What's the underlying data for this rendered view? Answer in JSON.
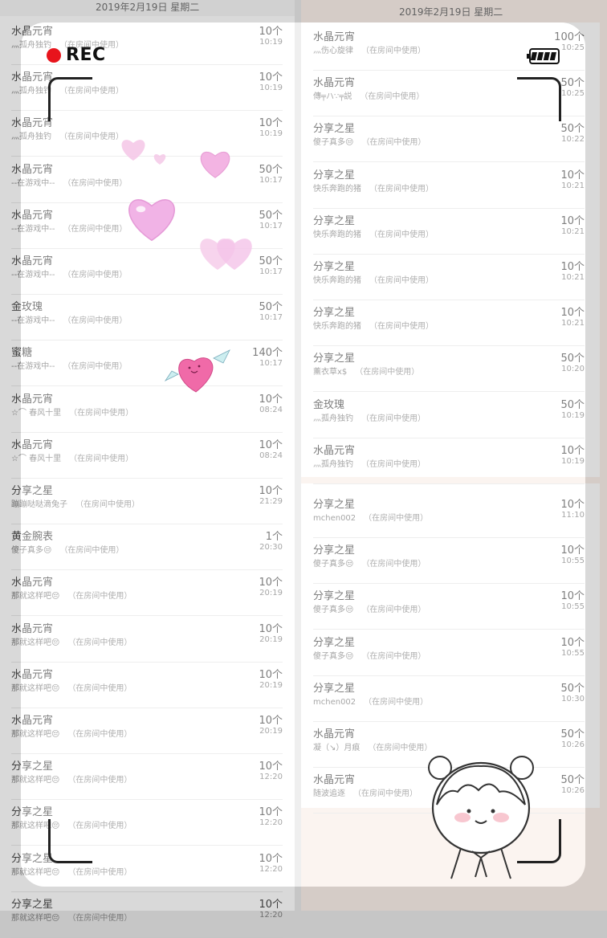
{
  "left_date": "2019年2月19日 星期二",
  "right_date": "2019年2月19日 星期二",
  "overlay": {
    "rec_label": "REC"
  },
  "left_list": [
    {
      "title": "水晶元宵",
      "sub": "灬孤舟独钓",
      "hint": "（在房间中使用）",
      "amount": "10个",
      "time": "10:19"
    },
    {
      "title": "水晶元宵",
      "sub": "灬孤舟独钓",
      "hint": "（在房间中使用）",
      "amount": "10个",
      "time": "10:19"
    },
    {
      "title": "水晶元宵",
      "sub": "灬孤舟独钓",
      "hint": "（在房间中使用）",
      "amount": "10个",
      "time": "10:19"
    },
    {
      "title": "水晶元宵",
      "sub": "--在游戏中--",
      "hint": "（在房间中使用）",
      "amount": "50个",
      "time": "10:17"
    },
    {
      "title": "水晶元宵",
      "sub": "--在游戏中--",
      "hint": "（在房间中使用）",
      "amount": "50个",
      "time": "10:17"
    },
    {
      "title": "水晶元宵",
      "sub": "--在游戏中--",
      "hint": "（在房间中使用）",
      "amount": "50个",
      "time": "10:17"
    },
    {
      "title": "金玫瑰",
      "sub": "--在游戏中--",
      "hint": "（在房间中使用）",
      "amount": "50个",
      "time": "10:17"
    },
    {
      "title": "蜜糖",
      "sub": "--在游戏中--",
      "hint": "（在房间中使用）",
      "amount": "140个",
      "time": "10:17"
    },
    {
      "title": "水晶元宵",
      "sub": "☆⌒ 春风十里",
      "hint": "（在房间中使用）",
      "amount": "10个",
      "time": "08:24"
    },
    {
      "title": "水晶元宵",
      "sub": "☆⌒ 春风十里",
      "hint": "（在房间中使用）",
      "amount": "10个",
      "time": "08:24"
    },
    {
      "title": "分享之星",
      "sub": "蹦蹦哒哒滴兔子",
      "hint": "（在房间中使用）",
      "amount": "10个",
      "time": "21:29"
    },
    {
      "title": "黄金腕表",
      "sub": "傻子真多😒",
      "hint": "（在房间中使用）",
      "amount": "1个",
      "time": "20:30"
    },
    {
      "title": "水晶元宵",
      "sub": "那就这样吧😔",
      "hint": "（在房间中使用）",
      "amount": "10个",
      "time": "20:19"
    },
    {
      "title": "水晶元宵",
      "sub": "那就这样吧😔",
      "hint": "（在房间中使用）",
      "amount": "10个",
      "time": "20:19"
    },
    {
      "title": "水晶元宵",
      "sub": "那就这样吧😔",
      "hint": "（在房间中使用）",
      "amount": "10个",
      "time": "20:19"
    },
    {
      "title": "水晶元宵",
      "sub": "那就这样吧😔",
      "hint": "（在房间中使用）",
      "amount": "10个",
      "time": "20:19"
    },
    {
      "title": "分享之星",
      "sub": "那就这样吧😔",
      "hint": "（在房间中使用）",
      "amount": "10个",
      "time": "12:20"
    },
    {
      "title": "分享之星",
      "sub": "那就这样吧😔",
      "hint": "（在房间中使用）",
      "amount": "10个",
      "time": "12:20"
    },
    {
      "title": "分享之星",
      "sub": "那就这样吧😔",
      "hint": "（在房间中使用）",
      "amount": "10个",
      "time": "12:20"
    },
    {
      "title": "分享之星",
      "sub": "那就这样吧😔",
      "hint": "（在房间中使用）",
      "amount": "10个",
      "time": "12:20"
    }
  ],
  "right_list_top": [
    {
      "title": "水晶元宵",
      "sub": "灬伤心旋律",
      "hint": "（在房间中使用）",
      "amount": "100个",
      "time": "10:25"
    },
    {
      "title": "水晶元宵",
      "sub": "傳╤ハ∵╤説",
      "hint": "（在房间中使用）",
      "amount": "50个",
      "time": "10:25"
    },
    {
      "title": "分享之星",
      "sub": "傻子真多😒",
      "hint": "（在房间中使用）",
      "amount": "50个",
      "time": "10:22"
    },
    {
      "title": "分享之星",
      "sub": "快乐奔跑的猪",
      "hint": "（在房间中使用）",
      "amount": "10个",
      "time": "10:21"
    },
    {
      "title": "分享之星",
      "sub": "快乐奔跑的猪",
      "hint": "（在房间中使用）",
      "amount": "10个",
      "time": "10:21"
    },
    {
      "title": "分享之星",
      "sub": "快乐奔跑的猪",
      "hint": "（在房间中使用）",
      "amount": "10个",
      "time": "10:21"
    },
    {
      "title": "分享之星",
      "sub": "快乐奔跑的猪",
      "hint": "（在房间中使用）",
      "amount": "10个",
      "time": "10:21"
    },
    {
      "title": "分享之星",
      "sub": "薰衣草x$",
      "hint": "（在房间中使用）",
      "amount": "50个",
      "time": "10:20"
    },
    {
      "title": "金玫瑰",
      "sub": "灬孤舟独钓",
      "hint": "（在房间中使用）",
      "amount": "50个",
      "time": "10:19"
    },
    {
      "title": "水晶元宵",
      "sub": "灬孤舟独钓",
      "hint": "（在房间中使用）",
      "amount": "10个",
      "time": "10:19"
    }
  ],
  "right_list_bottom": [
    {
      "title": "分享之星",
      "sub": "mchen002",
      "hint": "（在房间中使用）",
      "amount": "10个",
      "time": "11:10"
    },
    {
      "title": "分享之星",
      "sub": "傻子真多😒",
      "hint": "（在房间中使用）",
      "amount": "10个",
      "time": "10:55"
    },
    {
      "title": "分享之星",
      "sub": "傻子真多😒",
      "hint": "（在房间中使用）",
      "amount": "10个",
      "time": "10:55"
    },
    {
      "title": "分享之星",
      "sub": "傻子真多😒",
      "hint": "（在房间中使用）",
      "amount": "10个",
      "time": "10:55"
    },
    {
      "title": "分享之星",
      "sub": "mchen002",
      "hint": "（在房间中使用）",
      "amount": "50个",
      "time": "10:30"
    },
    {
      "title": "水晶元宵",
      "sub": "凝（↘）月痕",
      "hint": "（在房间中使用）",
      "amount": "50个",
      "time": "10:26"
    },
    {
      "title": "水晶元宵",
      "sub": "随波追逐",
      "hint": "（在房间中使用）",
      "amount": "50个",
      "time": "10:26"
    }
  ]
}
